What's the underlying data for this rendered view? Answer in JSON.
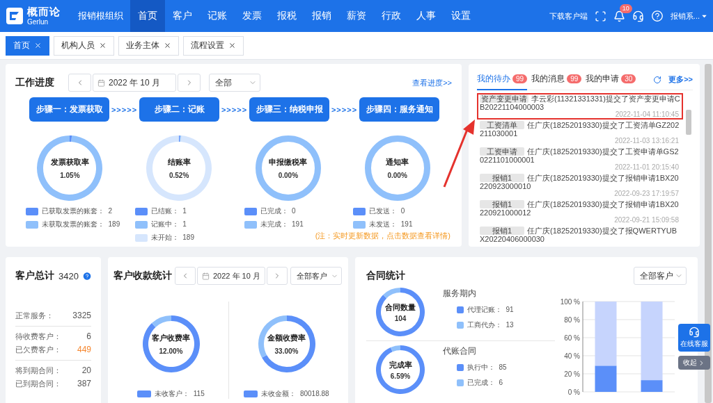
{
  "header": {
    "logo_name": "概而论",
    "logo_sub": "Gerlun",
    "org": "报销根组织",
    "nav": [
      {
        "label": "首页",
        "selected": true
      },
      {
        "label": "客户",
        "selected": false
      },
      {
        "label": "记账",
        "selected": false
      },
      {
        "label": "发票",
        "selected": false
      },
      {
        "label": "报税",
        "selected": false
      },
      {
        "label": "报销",
        "selected": false
      },
      {
        "label": "薪资",
        "selected": false
      },
      {
        "label": "行政",
        "selected": false
      },
      {
        "label": "人事",
        "selected": false
      },
      {
        "label": "设置",
        "selected": false
      }
    ],
    "download": "下载客户端",
    "notifications": "10",
    "user": "报销系..."
  },
  "tabs": [
    {
      "label": "首页",
      "selected": true
    },
    {
      "label": "机构人员",
      "selected": false
    },
    {
      "label": "业务主体",
      "selected": false
    },
    {
      "label": "流程设置",
      "selected": false
    }
  ],
  "progress": {
    "title": "工作进度",
    "month": "2022 年 10 月",
    "filter": "全部",
    "link": "查看进度>>",
    "steps": [
      {
        "label": "步骤一：发票获取",
        "next": ">>>>>"
      },
      {
        "label": "步骤二：记账",
        "next": ">>>>>"
      },
      {
        "label": "步骤三：纳税申报",
        "next": ">>>>>"
      },
      {
        "label": "步骤四：服务通知"
      }
    ],
    "rings": [
      {
        "title": "发票获取率",
        "value": "1.05%",
        "chart_data": {
          "type": "donut",
          "values": [
            1.05,
            98.95
          ],
          "colors": [
            "#5b8ff9",
            "#8fc0fb"
          ]
        },
        "legend": [
          {
            "label": "已获取发票的账套：",
            "value": "2",
            "color": "#5b8ff9"
          },
          {
            "label": "未获取发票的账套：",
            "value": "189",
            "color": "#8fc0fb"
          }
        ]
      },
      {
        "title": "结账率",
        "value": "0.52%",
        "chart_data": {
          "type": "donut",
          "values": [
            0.52,
            0.52,
            98.96
          ],
          "colors": [
            "#5b8ff9",
            "#8fc0fb",
            "#d6e6fd"
          ]
        },
        "legend": [
          {
            "label": "已结账：",
            "value": "1",
            "color": "#5b8ff9"
          },
          {
            "label": "记账中：",
            "value": "1",
            "color": "#8fc0fb"
          },
          {
            "label": "未开始：",
            "value": "189",
            "color": "#d6e6fd"
          }
        ]
      },
      {
        "title": "申报缴税率",
        "value": "0.00%",
        "legend": [
          {
            "label": "已完成：",
            "value": "0",
            "color": "#5b8ff9"
          },
          {
            "label": "未完成：",
            "value": "191",
            "color": "#8fc0fb"
          }
        ]
      },
      {
        "title": "通知率",
        "value": "0.00%",
        "legend": [
          {
            "label": "已发送：",
            "value": "0",
            "color": "#5b8ff9"
          },
          {
            "label": "未发送：",
            "value": "191",
            "color": "#8fc0fb"
          }
        ]
      }
    ],
    "note": "(注：实时更新数据，点击数据查看详情)"
  },
  "todo": {
    "tabs": [
      {
        "label": "我的待办",
        "count": "99",
        "selected": true
      },
      {
        "label": "我的消息",
        "count": "99",
        "selected": false
      },
      {
        "label": "我的申请",
        "count": "30",
        "selected": false
      }
    ],
    "more": "更多>>",
    "items": [
      {
        "tag": "资产变更申请",
        "text": "李云彩(11321331331)提交了资产变更申请CB20221104000003",
        "time": "2022-11-04 11:10:45",
        "highlighted": true
      },
      {
        "tag": "工资清单",
        "text": "任广庆(18252019330)提交了工资清单GZ202211030001",
        "time": "2022-11-03 13:16:21",
        "highlighted": false
      },
      {
        "tag": "工资申请",
        "text": "任广庆(18252019330)提交了工资申请单GS20221101000001",
        "time": "2022-11-01 20:15:40",
        "highlighted": false
      },
      {
        "tag": "报销1",
        "text": "任广庆(18252019330)提交了报销申请1BX20220923000010",
        "time": "2022-09-23 17:19:57",
        "highlighted": false
      },
      {
        "tag": "报销1",
        "text": "任广庆(18252019330)提交了报销申请1BX20220921000012",
        "time": "2022-09-21 15:09:58",
        "highlighted": false
      },
      {
        "tag": "报销1",
        "text": "任广庆(18252019330)提交了报QWERTYUBX20220406000030",
        "highlighted": false
      }
    ]
  },
  "customers": {
    "title": "客户总计",
    "total": "3420",
    "groups": [
      [
        {
          "label": "正常服务：",
          "value": "3325",
          "warning": false
        }
      ],
      [
        {
          "label": "待收费客户：",
          "value": "6",
          "warning": false
        },
        {
          "label": "已欠费客户：",
          "value": "449",
          "warning": true
        }
      ],
      [
        {
          "label": "将到期合同：",
          "value": "20",
          "warning": false
        },
        {
          "label": "已到期合同：",
          "value": "387",
          "warning": false
        }
      ]
    ]
  },
  "collection": {
    "title": "客户收款统计",
    "month": "2022 年 10 月",
    "filter": "全部客户",
    "rings": [
      {
        "title": "客户收费率",
        "value": "12.00%",
        "chart_data": {
          "type": "donut",
          "values": [
            88,
            12
          ],
          "colors": [
            "#5b8ff9",
            "#8fc0fb"
          ]
        },
        "legend": [
          {
            "label": "未收客户：",
            "value": "115",
            "color": "#5b8ff9"
          }
        ]
      },
      {
        "title": "金额收费率",
        "value": "33.00%",
        "chart_data": {
          "type": "donut",
          "values": [
            67,
            33
          ],
          "colors": [
            "#5b8ff9",
            "#8fc0fb"
          ]
        },
        "legend": [
          {
            "label": "未收金额：",
            "value": "80018.88",
            "color": "#5b8ff9"
          }
        ]
      }
    ]
  },
  "contracts": {
    "title": "合同统计",
    "filter": "全部客户",
    "groups": [
      {
        "heading": "服务期内",
        "title": "合同数量",
        "value": "104",
        "chart_data": {
          "type": "donut",
          "values": [
            87.5,
            12.5
          ],
          "colors": [
            "#5b8ff9",
            "#8fc0fb"
          ]
        },
        "legend": [
          {
            "label": "代理记账：",
            "value": "91",
            "color": "#5b8ff9"
          },
          {
            "label": "工商代办：",
            "value": "13",
            "color": "#8fc0fb"
          }
        ]
      },
      {
        "heading": "代账合同",
        "title": "完成率",
        "value": "6.59%",
        "chart_data": {
          "type": "donut",
          "values": [
            93.41,
            6.59
          ],
          "colors": [
            "#5b8ff9",
            "#8fc0fb"
          ]
        },
        "legend": [
          {
            "label": "执行中：",
            "value": "85",
            "color": "#5b8ff9"
          },
          {
            "label": "已完成：",
            "value": "6",
            "color": "#8fc0fb"
          }
        ]
      }
    ],
    "chart_data": {
      "type": "bar",
      "stacked": true,
      "grid": true,
      "ylim": [
        0,
        100
      ],
      "yticks": [
        {
          "value": 0,
          "label": "0 %"
        },
        {
          "value": 20,
          "label": "20 %"
        },
        {
          "value": 40,
          "label": "40 %"
        },
        {
          "value": 60,
          "label": "60 %"
        },
        {
          "value": 80,
          "label": "80 %"
        },
        {
          "value": 100,
          "label": "100 %"
        }
      ],
      "series": [
        {
          "color": "#5b8ff9",
          "values": [
            29,
            13
          ]
        },
        {
          "color": "#c6d4fd",
          "values": [
            71,
            87
          ]
        }
      ]
    }
  },
  "service": {
    "label": "在线客服",
    "collapse": "收起"
  }
}
